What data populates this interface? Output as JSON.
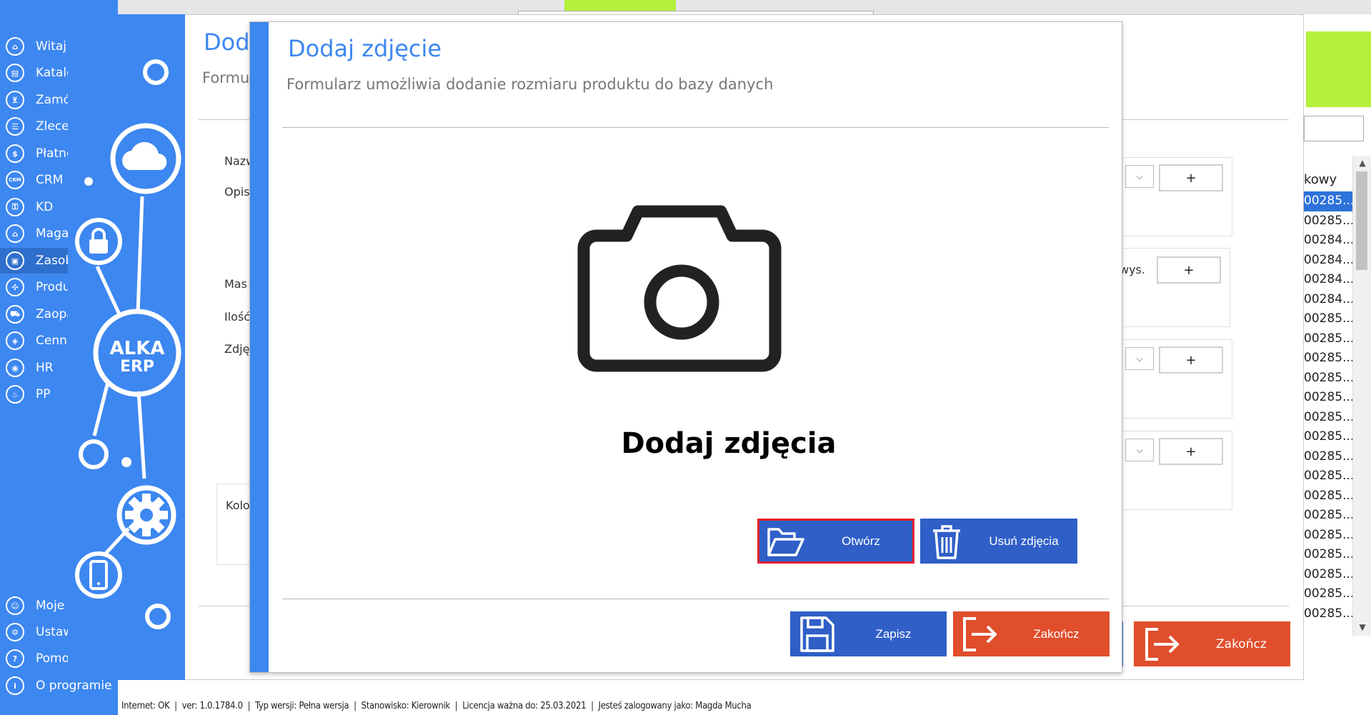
{
  "nav": {
    "items": [
      {
        "label": "Witaj!",
        "icon": "home-icon",
        "glyph": "⌂"
      },
      {
        "label": "Katalo",
        "icon": "catalog-book-icon",
        "glyph": "▤"
      },
      {
        "label": "Zamó",
        "icon": "cart-icon",
        "glyph": "⊻"
      },
      {
        "label": "Zlecer",
        "icon": "list-icon",
        "glyph": "☰"
      },
      {
        "label": "Płatno",
        "icon": "dollar-icon",
        "glyph": "$"
      },
      {
        "label": "CRM",
        "icon": "crm-icon",
        "glyph": "CRM"
      },
      {
        "label": "KD",
        "icon": "user-lock-icon",
        "glyph": "⚿"
      },
      {
        "label": "Magaz",
        "icon": "warehouse-icon",
        "glyph": "⌂"
      },
      {
        "label": "Zasob",
        "icon": "resources-box-icon",
        "glyph": "▣"
      },
      {
        "label": "Produ",
        "icon": "production-icon",
        "glyph": "✣"
      },
      {
        "label": "Zaopa",
        "icon": "supply-truck-icon",
        "glyph": "⛟"
      },
      {
        "label": "Cennik",
        "icon": "price-tag-icon",
        "glyph": "◈"
      },
      {
        "label": "HR",
        "icon": "hr-icon",
        "glyph": "◉"
      },
      {
        "label": "PP",
        "icon": "pp-icon",
        "glyph": "♨"
      }
    ],
    "bottom_items": [
      {
        "label": "Moje I",
        "icon": "profile-icon",
        "glyph": "☺"
      },
      {
        "label": "Ustawi",
        "icon": "settings-gear-icon",
        "glyph": "⚙"
      },
      {
        "label": "Pomo",
        "icon": "help-icon",
        "glyph": "?"
      },
      {
        "label": "O programie",
        "icon": "info-icon",
        "glyph": "i"
      }
    ],
    "active_index": 8
  },
  "status_bar": {
    "internet": "Internet: OK",
    "version": "ver: 1.0.1784.0",
    "edition": "Typ wersji: Pełna wersja",
    "workstation": "Stanowisko: Kierownik",
    "license": "Licencja ważna do: 25.03.2021",
    "user": "Jesteś zalogowany jako: Magda Mucha",
    "separator": "|"
  },
  "background_form": {
    "title": "Dod",
    "subtitle": "Formu",
    "labels": [
      "Nazw",
      "Opis",
      "Mas",
      "Ilość",
      "Zdję",
      "Kolo"
    ],
    "combo_arrow": "⌵",
    "plus_label": "+",
    "height_label": "wys.",
    "close_label": "Zakończ",
    "list_header": "kowy",
    "list_rows": [
      "00285...",
      "00285...",
      "00284...",
      "00284...",
      "00284...",
      "00284...",
      "00285...",
      "00285...",
      "00285...",
      "00285...",
      "00285...",
      "00285...",
      "00285...",
      "00285...",
      "00285...",
      "00285...",
      "00285...",
      "00285...",
      "00285...",
      "00285...",
      "00285...",
      "00285..."
    ],
    "selected_row": 0,
    "scroll_up": "▲",
    "scroll_down": "▼"
  },
  "branding": {
    "logo_line1": "ALKA",
    "logo_line2": "ERP"
  },
  "dialog": {
    "title": "Dodaj zdjęcie",
    "subtitle": "Formularz umożliwia dodanie rozmiaru produktu do bazy danych",
    "placeholder_caption": "Dodaj zdjęcia",
    "open_button": "Otwórz",
    "remove_button": "Usuń zdjęcia",
    "save_button": "Zapisz",
    "close_button": "Zakończ"
  },
  "colors": {
    "brand_blue": "#3d87f0",
    "button_blue": "#2f5fc7",
    "button_red": "#e04e2c",
    "accent_green": "#b4f03c",
    "focus_red": "#e0202e"
  }
}
